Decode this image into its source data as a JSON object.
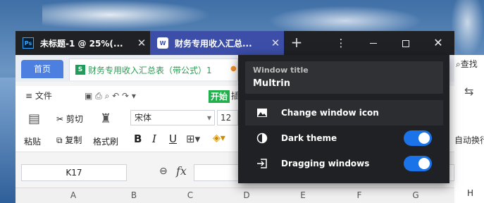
{
  "tabs": [
    {
      "title": "未标题-1 @ 25%(...",
      "icon": "photoshop-icon",
      "icon_text": "Ps"
    },
    {
      "title": "财务专用收入汇总...",
      "icon": "wps-icon",
      "icon_text": "W"
    }
  ],
  "tab_add_label": "+",
  "window_controls": {
    "menu": "⋮",
    "close": "✕"
  },
  "wps": {
    "home_tab": "首页",
    "doc_tab": "财务专用收入汇总表（带公式）1",
    "doc_icon_text": "S",
    "menu_file": "≡ 文件",
    "kaishi": "开始",
    "cha": "插",
    "find": "查找",
    "paste": "粘贴",
    "cut": "剪切",
    "copy": "复制",
    "format_painter": "格式刷",
    "font": "宋体",
    "font_size": "12",
    "bold": "B",
    "italic": "I",
    "underline": "U",
    "auto_wrap": "自动换行",
    "namebox": "K17",
    "fx": "fx",
    "columns": [
      "A",
      "B",
      "C",
      "D",
      "E",
      "F",
      "G",
      "H"
    ]
  },
  "panel": {
    "title_label": "Window title",
    "title_value": "Multrin",
    "items": [
      {
        "label": "Change window icon",
        "icon": "image-icon"
      },
      {
        "label": "Dark theme",
        "icon": "contrast-icon",
        "toggle": true
      },
      {
        "label": "Dragging windows",
        "icon": "enter-window-icon",
        "toggle": true
      }
    ]
  },
  "colors": {
    "accent": "#1a73e8",
    "active_tab": "#3c4ea8",
    "panel_bg": "#202124"
  }
}
